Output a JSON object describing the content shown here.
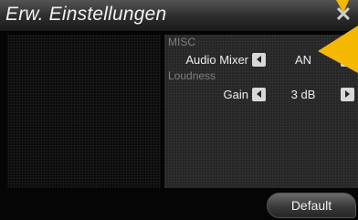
{
  "window": {
    "title": "Erw. Einstellungen"
  },
  "icons": {
    "close": "close-icon",
    "left_arrow": "arrow-left-icon",
    "right_arrow": "arrow-right-icon"
  },
  "sections": [
    {
      "header": "MISC",
      "rows": [
        {
          "label": "Audio Mixer",
          "value": "AN"
        }
      ]
    },
    {
      "header": "Loudness",
      "rows": [
        {
          "label": "Gain",
          "value": "3 dB"
        }
      ]
    }
  ],
  "footer": {
    "default_label": "Default"
  },
  "colors": {
    "accent_arrow": "#f5b800",
    "panel": "#262626",
    "background": "#050505"
  }
}
